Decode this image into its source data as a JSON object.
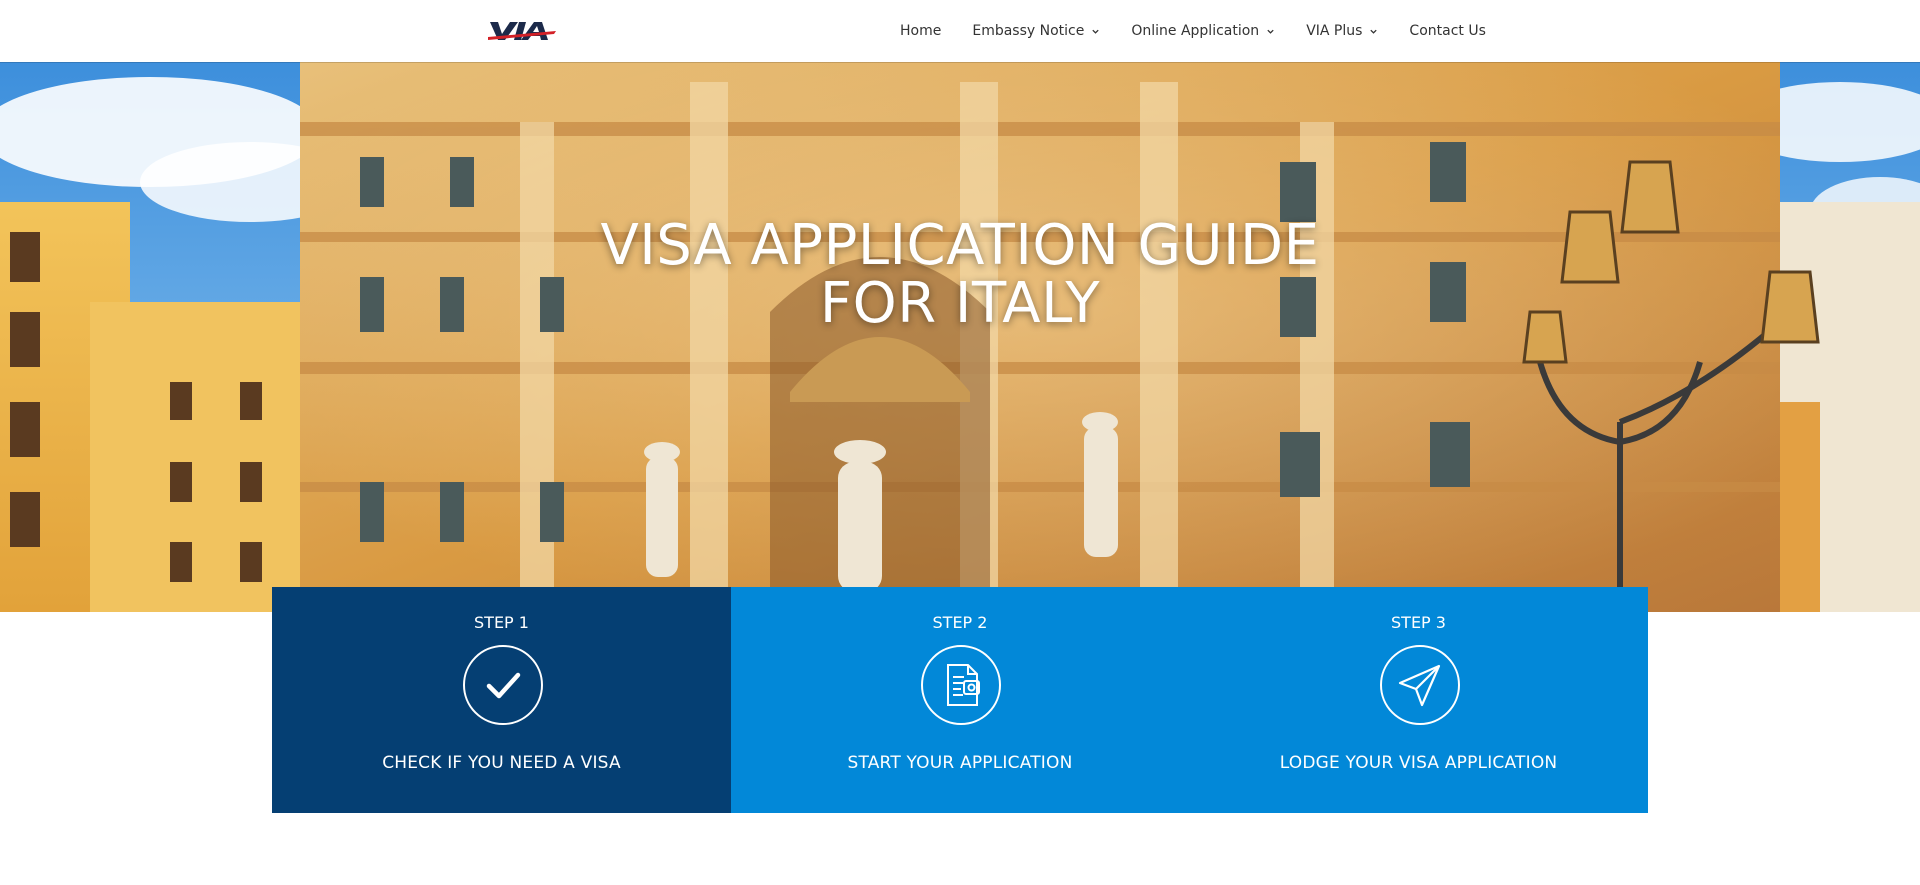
{
  "header": {
    "logo": {
      "text": "VIA",
      "icon": "via-logo-icon"
    },
    "nav": [
      {
        "label": "Home",
        "has_dropdown": false
      },
      {
        "label": "Embassy Notice",
        "has_dropdown": true
      },
      {
        "label": "Online Application",
        "has_dropdown": true
      },
      {
        "label": "VIA Plus",
        "has_dropdown": true
      },
      {
        "label": "Contact Us",
        "has_dropdown": false
      }
    ]
  },
  "hero": {
    "title_line1": "VISA APPLICATION GUIDE",
    "title_line2": "FOR ITALY"
  },
  "steps": [
    {
      "number": "STEP 1",
      "label": "CHECK IF YOU NEED A VISA",
      "icon": "checkmark-icon"
    },
    {
      "number": "STEP 2",
      "label": "START YOUR APPLICATION",
      "icon": "document-icon"
    },
    {
      "number": "STEP 3",
      "label": "LODGE YOUR VISA APPLICATION",
      "icon": "paper-plane-icon"
    }
  ],
  "colors": {
    "step_active": "#053f73",
    "step_default": "#0288d8",
    "logo_red": "#d32027",
    "logo_navy": "#1c2a4a"
  }
}
